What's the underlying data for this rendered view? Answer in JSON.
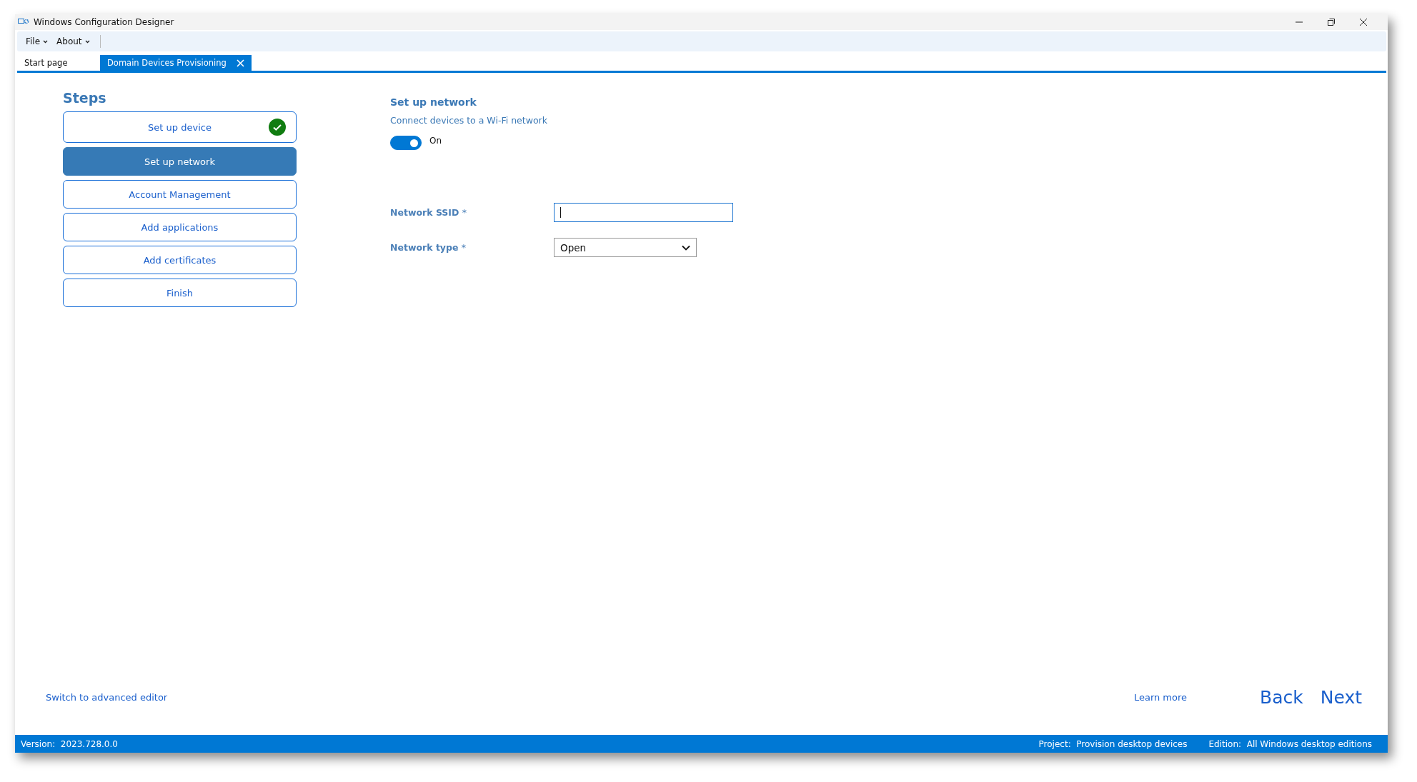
{
  "window": {
    "title": "Windows Configuration Designer"
  },
  "menu": [
    {
      "label": "File"
    },
    {
      "label": "About"
    }
  ],
  "tabs": [
    {
      "label": "Start page",
      "selected": false,
      "closable": false
    },
    {
      "label": "Domain Devices Provisioning",
      "selected": true,
      "closable": true
    }
  ],
  "steps": {
    "title": "Steps",
    "items": [
      {
        "label": "Set up device",
        "selected": false,
        "completed": true
      },
      {
        "label": "Set up network",
        "selected": true,
        "completed": false
      },
      {
        "label": "Account Management",
        "selected": false,
        "completed": false
      },
      {
        "label": "Add applications",
        "selected": false,
        "completed": false
      },
      {
        "label": "Add certificates",
        "selected": false,
        "completed": false
      },
      {
        "label": "Finish",
        "selected": false,
        "completed": false
      }
    ]
  },
  "panel": {
    "title": "Set up network",
    "subtitle": "Connect devices to a Wi-Fi network",
    "toggle": {
      "on": true,
      "label": "On"
    },
    "fields": [
      {
        "kind": "text",
        "label": "Network SSID",
        "required": "*"
      },
      {
        "kind": "dropdown",
        "label": "Network type",
        "required": "*",
        "value": "Open"
      }
    ]
  },
  "footer": {
    "advanced_link": "Switch to advanced editor",
    "learn_more": "Learn more",
    "back": "Back",
    "next": "Next"
  },
  "status_bar": {
    "version_label": "Version:",
    "version": "2023.728.0.0",
    "project_label": "Project:",
    "project": "Provision desktop devices",
    "edition_label": "Edition:",
    "edition": "All Windows desktop editions"
  }
}
